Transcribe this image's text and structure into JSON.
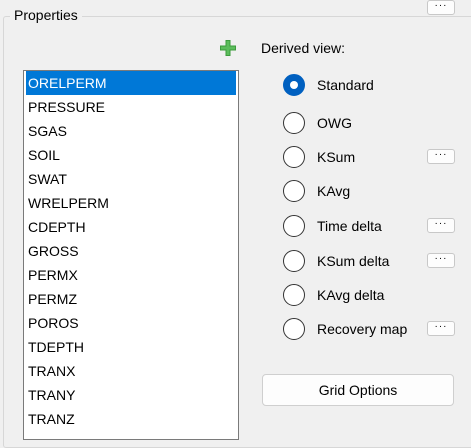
{
  "group": {
    "title": "Properties"
  },
  "add_button": {
    "icon": "plus-icon",
    "color": "#3c9c3c"
  },
  "properties": {
    "selected": "ORELPERM",
    "items": [
      "ORELPERM",
      "PRESSURE",
      "SGAS",
      "SOIL",
      "SWAT",
      "WRELPERM",
      "CDEPTH",
      "GROSS",
      "PERMX",
      "PERMZ",
      "POROS",
      "TDEPTH",
      "TRANX",
      "TRANY",
      "TRANZ"
    ]
  },
  "derived_view": {
    "label": "Derived view:",
    "options": [
      {
        "label": "Standard",
        "checked": true,
        "has_more": false
      },
      {
        "label": "OWG",
        "checked": false,
        "has_more": true
      },
      {
        "label": "KSum",
        "checked": false,
        "has_more": true
      },
      {
        "label": "KAvg",
        "checked": false,
        "has_more": false
      },
      {
        "label": "Time delta",
        "checked": false,
        "has_more": true
      },
      {
        "label": "KSum delta",
        "checked": false,
        "has_more": true
      },
      {
        "label": "KAvg delta",
        "checked": false,
        "has_more": false
      },
      {
        "label": "Recovery map",
        "checked": false,
        "has_more": true
      }
    ],
    "more_label": "···"
  },
  "grid_options": {
    "label": "Grid Options"
  },
  "colors": {
    "selection": "#0078d7",
    "radio_checked": "#0060c0"
  }
}
